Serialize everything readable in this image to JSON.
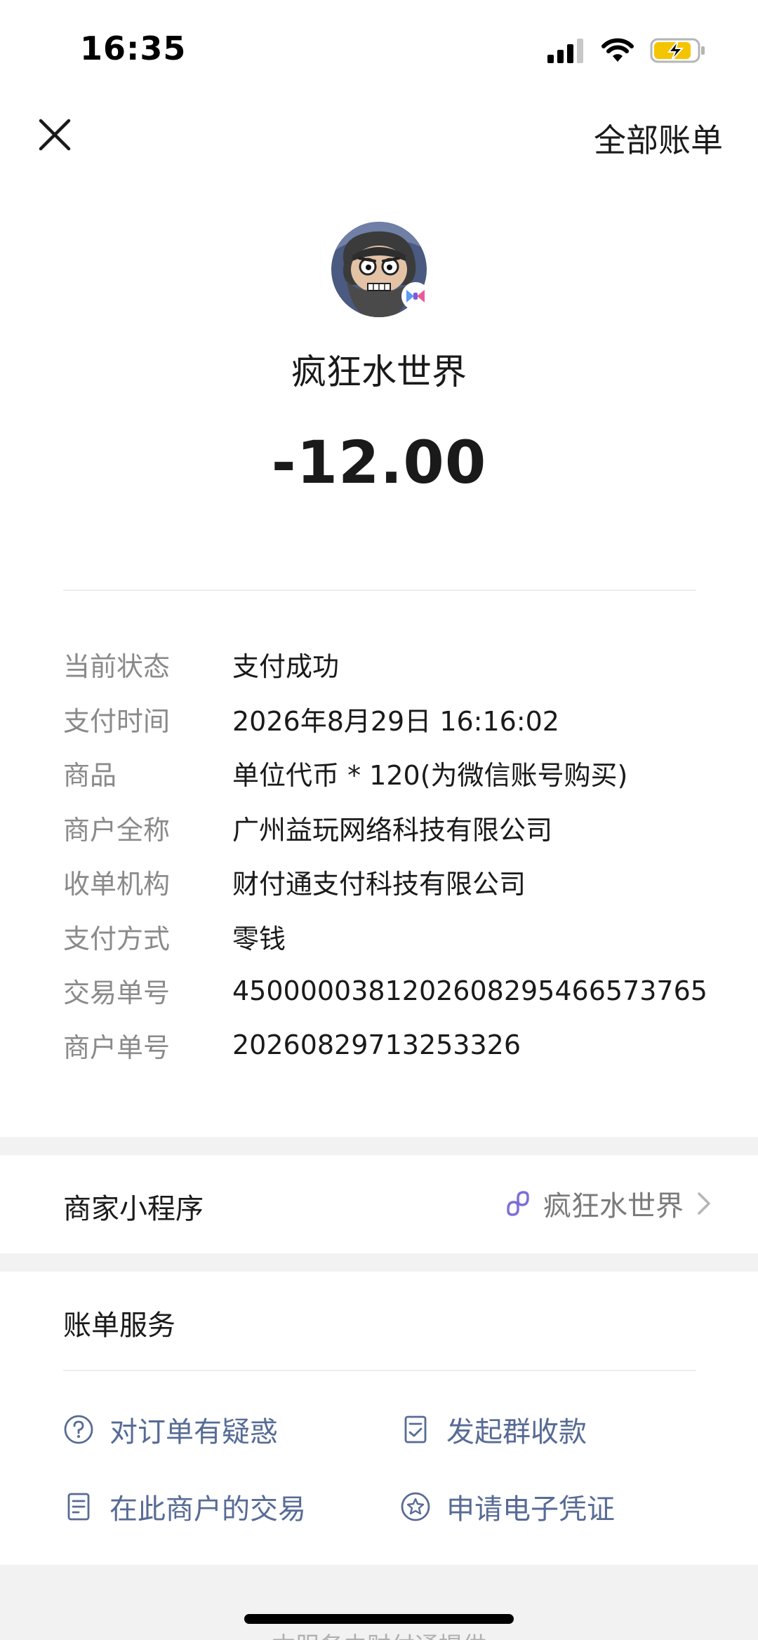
{
  "status_bar": {
    "time": "16:35",
    "icons": [
      "signal-icon",
      "wifi-icon",
      "battery-charging-icon"
    ]
  },
  "nav": {
    "close_icon": "close-icon",
    "all_bills_label": "全部账单"
  },
  "merchant": {
    "avatar_icon": "merchant-avatar",
    "name": "疯狂水世界",
    "amount": "-12.00"
  },
  "details": {
    "rows": [
      {
        "label": "当前状态",
        "value": "支付成功"
      },
      {
        "label": "支付时间",
        "value": "2026年8月29日 16:16:02"
      },
      {
        "label": "商品",
        "value": "单位代币 * 120(为微信账号购买)"
      },
      {
        "label": "商户全称",
        "value": "广州益玩网络科技有限公司"
      },
      {
        "label": "收单机构",
        "value": "财付通支付科技有限公司"
      },
      {
        "label": "支付方式",
        "value": "零钱"
      },
      {
        "label": "交易单号",
        "value": "4500000381202608295466573765"
      },
      {
        "label": "商户单号",
        "value": "20260829713253326"
      }
    ]
  },
  "mini_program": {
    "label": "商家小程序",
    "name": "疯狂水世界",
    "icon": "mini-program-link-icon"
  },
  "bill_service": {
    "title": "账单服务",
    "items": [
      {
        "label": "对订单有疑惑",
        "icon": "question-icon"
      },
      {
        "label": "发起群收款",
        "icon": "group-collect-icon"
      },
      {
        "label": "在此商户的交易",
        "icon": "receipt-icon"
      },
      {
        "label": "申请电子凭证",
        "icon": "star-badge-icon"
      }
    ]
  },
  "footer": {
    "text": "本服务由财付通提供"
  },
  "colors": {
    "link": "#576b95",
    "muted": "#8a8a8a",
    "background_band": "#f2f2f2",
    "battery": "#f5c400"
  }
}
